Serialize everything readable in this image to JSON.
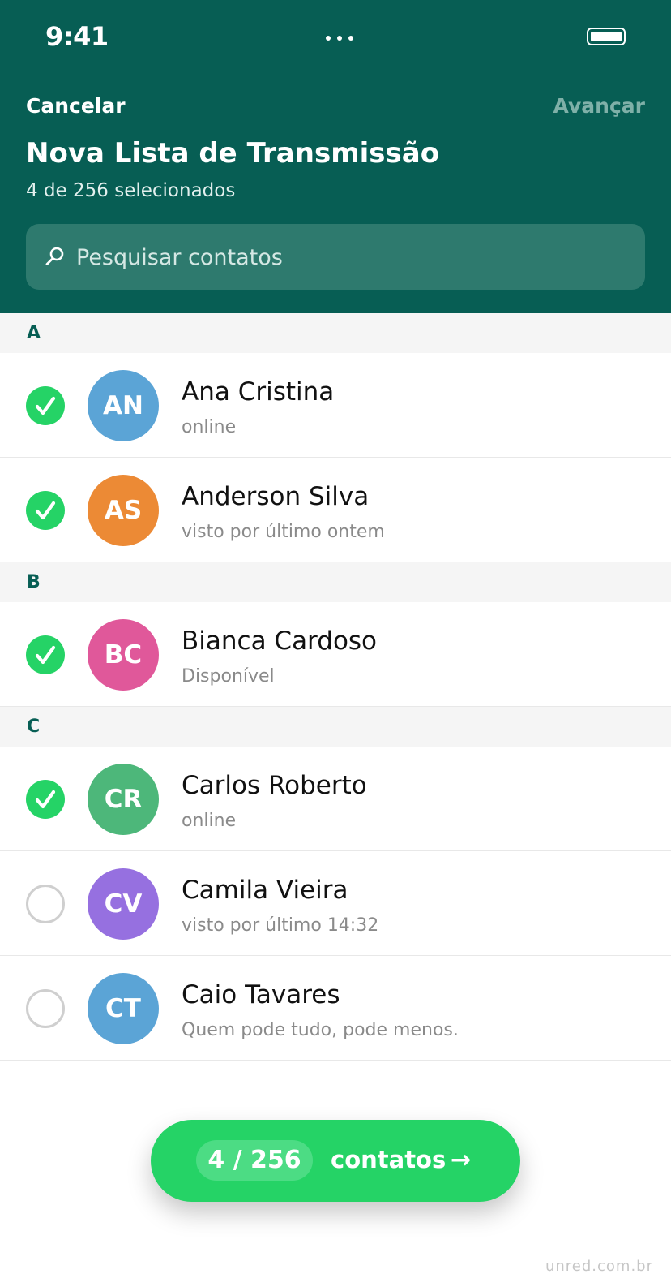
{
  "status_bar": {
    "time": "9:41"
  },
  "header": {
    "cancel_label": "Cancelar",
    "next_label": "Avançar",
    "title": "Nova Lista de Transmissão",
    "subtitle": "4 de 256 selecionados"
  },
  "search": {
    "placeholder": "Pesquisar contatos",
    "value": ""
  },
  "sections": [
    {
      "letter": "A",
      "contacts": [
        {
          "name": "Ana Cristina",
          "status": "online",
          "initials": "AN",
          "selected": true,
          "color": "#5ba4d6"
        },
        {
          "name": "Anderson Silva",
          "status": "visto por último ontem",
          "initials": "AS",
          "selected": true,
          "color": "#ec8a35"
        }
      ]
    },
    {
      "letter": "B",
      "contacts": [
        {
          "name": "Bianca Cardoso",
          "status": "Disponível",
          "initials": "BC",
          "selected": true,
          "color": "#e0589a"
        }
      ]
    },
    {
      "letter": "C",
      "contacts": [
        {
          "name": "Carlos Roberto",
          "status": "online",
          "initials": "CR",
          "selected": true,
          "color": "#4db77a"
        },
        {
          "name": "Camila Vieira",
          "status": "visto por último 14:32",
          "initials": "CV",
          "selected": false,
          "color": "#9670e0"
        },
        {
          "name": "Caio Tavares",
          "status": "Quem pode tudo, pode menos.",
          "initials": "CT",
          "selected": false,
          "color": "#5ba4d6"
        }
      ]
    }
  ],
  "fab": {
    "count": "4 / 256",
    "label": "contatos",
    "arrow": "→"
  },
  "watermark": "unred.com.br",
  "colors": {
    "header": "#075e54",
    "accent": "#25d366",
    "section_text": "#075e54"
  },
  "icons": {
    "search": "search-icon",
    "check": "check-icon",
    "battery": "battery-icon",
    "more": "more-dots-icon"
  }
}
